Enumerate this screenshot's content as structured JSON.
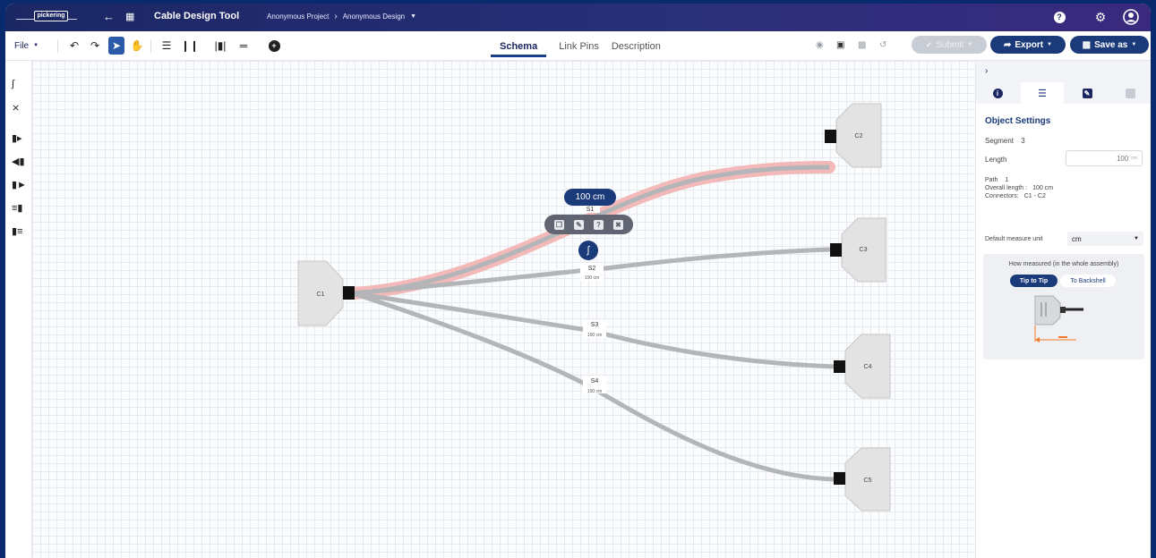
{
  "app": {
    "logo_text": "pickering",
    "title": "Cable Design Tool",
    "breadcrumb": [
      "Anonymous Project",
      "Anonymous Design"
    ]
  },
  "toolbar": {
    "file_label": "File",
    "tabs": [
      "Schema",
      "Link Pins",
      "Description"
    ],
    "selected_tab": "Schema",
    "submit_label": "Submit",
    "export_label": "Export",
    "save_label": "Save as"
  },
  "canvas": {
    "selected_segment_length": "100 cm",
    "connectors": [
      {
        "id": "C1"
      },
      {
        "id": "C2"
      },
      {
        "id": "C3"
      },
      {
        "id": "C4"
      },
      {
        "id": "C5"
      }
    ],
    "segments": [
      {
        "id": "S1",
        "length": "100 cm",
        "selected": true
      },
      {
        "id": "S2",
        "length": "100 cm"
      },
      {
        "id": "S3",
        "length": "100 cm"
      },
      {
        "id": "S4",
        "length": "100 cm"
      }
    ]
  },
  "panel": {
    "title": "Object Settings",
    "segment_label": "Segment",
    "segment_value": "3",
    "length_label": "Length",
    "length_value": "100",
    "length_unit": "cm",
    "path_label": "Path",
    "path_value": "1",
    "overall_length_label": "Overall length :",
    "overall_length_value": "100 cm",
    "connectors_label": "Connectors:",
    "connectors_value": "C1 - C2",
    "default_unit_label": "Default measure unit",
    "default_unit_value": "cm",
    "measure_title": "How measured (in the whole assembly)",
    "tip_to_tip": "Tip to Tip",
    "to_backshell": "To Backshell"
  },
  "colors": {
    "brand": "#1b2763",
    "accent": "#1b3a7a",
    "selection": "#f3b9b9",
    "wire": "#b3b5b8"
  }
}
